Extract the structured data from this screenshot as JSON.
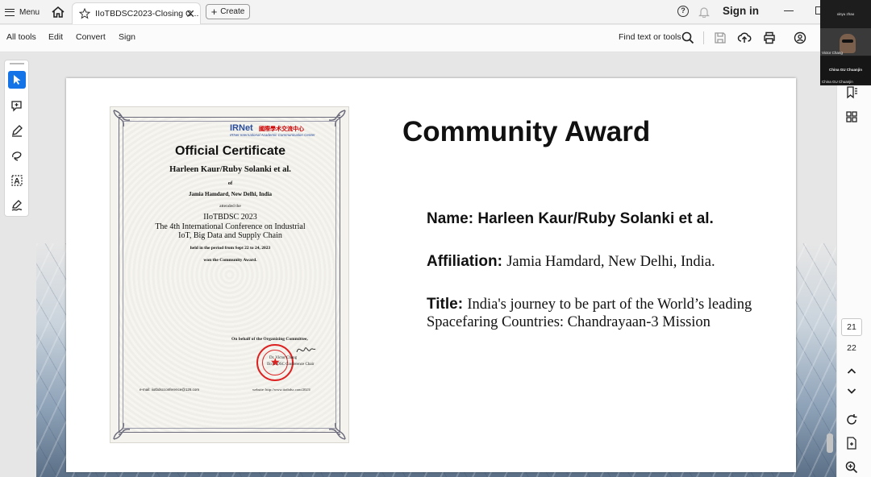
{
  "topbar": {
    "menu_label": "Menu",
    "tab_title": "IIoTBDSC2023-Closing C...",
    "create_label": "Create",
    "signin_label": "Sign in"
  },
  "toolbar": {
    "items": [
      "All tools",
      "Edit",
      "Convert",
      "Sign"
    ],
    "find_label": "Find text or tools"
  },
  "certificate": {
    "org": "IRNet",
    "org_cn": "國際學术交流中心",
    "org_sub": "IRNet International Academic Communication Center",
    "heading": "Official Certificate",
    "recipient": "Harleen Kaur/Ruby Solanki et al.",
    "of": "of",
    "affiliation": "Jamia Hamdard, New Delhi, India",
    "attended": "attended the",
    "conf_short": "IIoTBDSC 2023",
    "conf_line1": "The 4th International Conference on Industrial",
    "conf_line2": "IoT, Big Data and Supply Chain",
    "period": "held in the period from Sept 22 to 24, 2023",
    "award": "won the Community Award.",
    "behalf": "On behalf of the Organizing Committee,",
    "signer": "Dr. Victor Chang",
    "signer_role": "IIoTBDSC Conference Chair",
    "email": "e-mail: iiotbdscconference@126.com",
    "website": "website: http://www.iiotbdsc.com/2023/"
  },
  "slide": {
    "title": "Community Award",
    "name_key": "Name:",
    "name_val": "Harleen Kaur/Ruby Solanki et al.",
    "aff_key": "Affiliation:",
    "aff_val": "Jamia Hamdard, New Delhi, India.",
    "title_key": "Title:",
    "title_val_1": "India's journey to be part of the World’s leading",
    "title_val_2": "Spacefaring Countries: Chandrayaan-3 Mission"
  },
  "rail": {
    "current_page": "21",
    "next_page": "22"
  },
  "video": {
    "tile1": "xinyu zhao",
    "tile2_label": "Victor Chang",
    "tile3": "China GU Chuanjin",
    "tile3_label": "China GU Chuanjin"
  },
  "colors": {
    "accent": "#1473e6",
    "seal": "#dd2222",
    "logo": "#2a4d9c"
  }
}
